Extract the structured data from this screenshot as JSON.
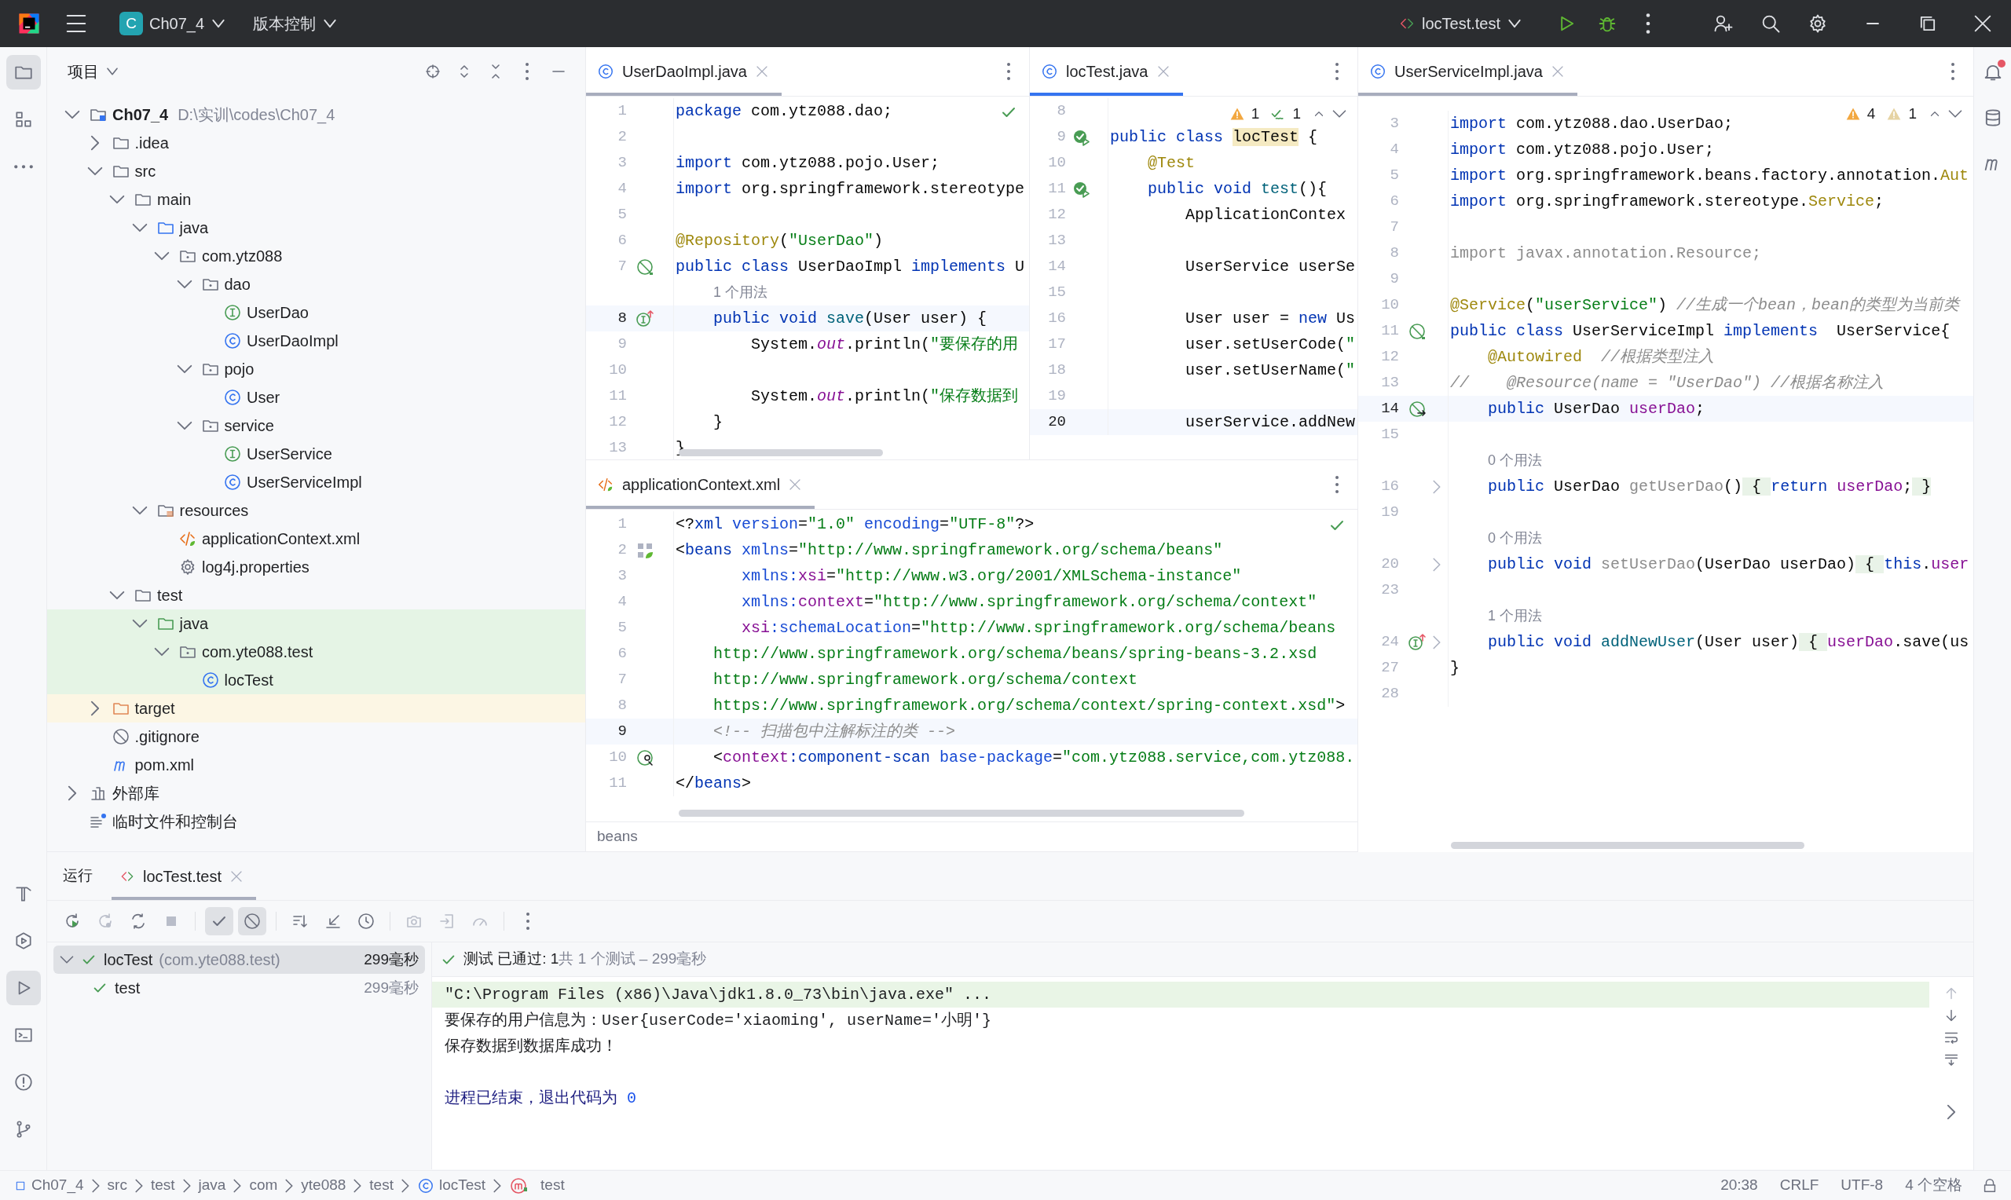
{
  "title_bar": {
    "project_letter": "C",
    "project": "Ch07_4",
    "vcs": "版本控制",
    "run_config": "locTest.test"
  },
  "tool_windows": {
    "left_top": [
      {
        "kind": "project",
        "selected": true
      },
      {
        "kind": "structure",
        "selected": false
      },
      {
        "kind": "more",
        "selected": false
      }
    ],
    "left_bottom": [
      {
        "kind": "build",
        "selected": false
      },
      {
        "kind": "services",
        "selected": false
      },
      {
        "kind": "run",
        "selected": true
      },
      {
        "kind": "terminal",
        "selected": false
      },
      {
        "kind": "problems",
        "selected": false
      },
      {
        "kind": "git",
        "selected": false
      }
    ],
    "right": [
      {
        "kind": "notifications",
        "badge": true
      },
      {
        "kind": "database"
      },
      {
        "kind": "maven"
      }
    ]
  },
  "project": {
    "title": "项目",
    "tree": [
      {
        "kind": "module",
        "label": "Ch07_4",
        "path": "D:\\实训\\codes\\Ch07_4",
        "expanded": true,
        "children": [
          {
            "kind": "folder",
            "label": ".idea",
            "expanded": false
          },
          {
            "kind": "folder",
            "label": "src",
            "expanded": true,
            "children": [
              {
                "kind": "folder",
                "label": "main",
                "expanded": true,
                "children": [
                  {
                    "kind": "source",
                    "label": "java",
                    "expanded": true,
                    "children": [
                      {
                        "kind": "package",
                        "label": "com.ytz088",
                        "expanded": true,
                        "children": [
                          {
                            "kind": "package",
                            "label": "dao",
                            "expanded": true,
                            "children": [
                              {
                                "kind": "interface",
                                "label": "UserDao"
                              },
                              {
                                "kind": "class",
                                "label": "UserDaoImpl"
                              }
                            ]
                          },
                          {
                            "kind": "package",
                            "label": "pojo",
                            "expanded": true,
                            "children": [
                              {
                                "kind": "class",
                                "label": "User"
                              }
                            ]
                          },
                          {
                            "kind": "package",
                            "label": "service",
                            "expanded": true,
                            "children": [
                              {
                                "kind": "interface",
                                "label": "UserService"
                              },
                              {
                                "kind": "class",
                                "label": "UserServiceImpl"
                              }
                            ]
                          }
                        ]
                      }
                    ]
                  },
                  {
                    "kind": "resources",
                    "label": "resources",
                    "expanded": true,
                    "children": [
                      {
                        "kind": "xml",
                        "label": "applicationContext.xml"
                      },
                      {
                        "kind": "properties",
                        "label": "log4j.properties"
                      }
                    ]
                  }
                ]
              },
              {
                "kind": "folder",
                "label": "test",
                "expanded": true,
                "children": [
                  {
                    "kind": "test-source",
                    "label": "java",
                    "expanded": true,
                    "color": "#e5f4e5",
                    "children": [
                      {
                        "kind": "package",
                        "label": "com.yte088.test",
                        "expanded": true,
                        "color": "#e5f4e5",
                        "children": [
                          {
                            "kind": "class",
                            "label": "locTest",
                            "color": "#e5f4e5"
                          }
                        ]
                      }
                    ]
                  }
                ]
              }
            ]
          },
          {
            "kind": "excluded",
            "label": "target",
            "expanded": false,
            "color": "#fcf6e4"
          },
          {
            "kind": "ignore",
            "label": ".gitignore"
          },
          {
            "kind": "maven",
            "label": "pom.xml"
          }
        ]
      },
      {
        "kind": "library",
        "label": "外部库",
        "expanded": false
      },
      {
        "kind": "scratch",
        "label": "临时文件和控制台"
      }
    ]
  },
  "editors": [
    {
      "focused": false,
      "tabs": [
        {
          "label": "UserDaoImpl.java",
          "kind": "class",
          "selected": true
        }
      ],
      "inspection": {
        "kind": "ok"
      },
      "lines": [
        {
          "n": "1",
          "tokens": [
            {
              "text": "package",
              "kind": "kw"
            },
            {
              "text": " com.ytz088.dao;",
              "kind": "plain"
            }
          ]
        },
        {
          "n": "2"
        },
        {
          "n": "3",
          "tokens": [
            {
              "text": "import",
              "kind": "kw"
            },
            {
              "text": " com.ytz088.pojo.User;",
              "kind": "plain"
            }
          ]
        },
        {
          "n": "4",
          "tokens": [
            {
              "text": "import",
              "kind": "kw"
            },
            {
              "text": " org.springframework.stereotype",
              "kind": "plain"
            }
          ]
        },
        {
          "n": "5"
        },
        {
          "n": "6",
          "tokens": [
            {
              "text": "@Repository",
              "kind": "ann"
            },
            {
              "text": "(",
              "kind": "plain"
            },
            {
              "text": "\"UserDao\"",
              "kind": "str"
            },
            {
              "text": ")",
              "kind": "plain"
            }
          ]
        },
        {
          "n": "7",
          "marker": {
            "kind": "bean"
          },
          "tokens": [
            {
              "text": "public class",
              "kind": "kw"
            },
            {
              "text": " UserDaoImpl ",
              "kind": "plain"
            },
            {
              "text": "implements",
              "kind": "kw"
            },
            {
              "text": " U",
              "kind": "plain"
            }
          ]
        },
        {
          "kind": "hint",
          "text": "1 个用法"
        },
        {
          "n": "8",
          "marker": {
            "kind": "impl"
          },
          "current": true,
          "tokens": [
            {
              "text": "    public void",
              "kind": "kw"
            },
            {
              "text": " save",
              "kind": "decl"
            },
            {
              "text": "(User user) {",
              "kind": "plain"
            }
          ]
        },
        {
          "n": "9",
          "tokens": [
            {
              "text": "        System.",
              "kind": "plain"
            },
            {
              "text": "out",
              "kind": "static"
            },
            {
              "text": ".println(",
              "kind": "plain"
            },
            {
              "text": "\"要保存的用",
              "kind": "str"
            }
          ]
        },
        {
          "n": "10"
        },
        {
          "n": "11",
          "tokens": [
            {
              "text": "        System.",
              "kind": "plain"
            },
            {
              "text": "out",
              "kind": "static"
            },
            {
              "text": ".println(",
              "kind": "plain"
            },
            {
              "text": "\"保存数据到",
              "kind": "str"
            }
          ]
        },
        {
          "n": "12",
          "tokens": [
            {
              "text": "    }",
              "kind": "plain"
            }
          ]
        },
        {
          "n": "13",
          "tokens": [
            {
              "text": "}",
              "kind": "plain"
            }
          ]
        }
      ]
    },
    {
      "focused": true,
      "tabs": [
        {
          "label": "locTest.java",
          "kind": "class",
          "selected": true
        }
      ],
      "inspection": {
        "kind": "counts",
        "counts": [
          {
            "kind": "warning",
            "text": "1"
          },
          {
            "kind": "typo",
            "text": "1"
          }
        ]
      },
      "lines": [
        {
          "n": "8"
        },
        {
          "n": "9",
          "marker": {
            "kind": "run"
          },
          "tokens": [
            {
              "text": "public class ",
              "kind": "kw"
            },
            {
              "text": "locTest",
              "kind": "match"
            },
            {
              "text": " {",
              "kind": "plain"
            }
          ]
        },
        {
          "n": "10",
          "tokens": [
            {
              "text": "    @Test",
              "kind": "ann"
            }
          ]
        },
        {
          "n": "11",
          "marker": {
            "kind": "run"
          },
          "tokens": [
            {
              "text": "    public void",
              "kind": "kw"
            },
            {
              "text": " test",
              "kind": "decl"
            },
            {
              "text": "(){",
              "kind": "plain"
            }
          ]
        },
        {
          "n": "12",
          "tokens": [
            {
              "text": "        ApplicationContex",
              "kind": "plain"
            }
          ]
        },
        {
          "n": "13"
        },
        {
          "n": "14",
          "tokens": [
            {
              "text": "        UserService userSe",
              "kind": "plain"
            }
          ]
        },
        {
          "n": "15"
        },
        {
          "n": "16",
          "tokens": [
            {
              "text": "        User user = ",
              "kind": "plain"
            },
            {
              "text": "new",
              "kind": "kw"
            },
            {
              "text": " Us",
              "kind": "plain"
            }
          ]
        },
        {
          "n": "17",
          "tokens": [
            {
              "text": "        user.setUserCode(",
              "kind": "plain"
            },
            {
              "text": "\"",
              "kind": "str"
            }
          ]
        },
        {
          "n": "18",
          "tokens": [
            {
              "text": "        user.setUserName(",
              "kind": "plain"
            },
            {
              "text": "\"",
              "kind": "str"
            }
          ]
        },
        {
          "n": "19"
        },
        {
          "n": "20",
          "current": true,
          "tokens": [
            {
              "text": "        userService.addNew",
              "kind": "plain"
            }
          ]
        }
      ]
    },
    {
      "focused": false,
      "tabs": [
        {
          "label": "applicationContext.xml",
          "kind": "xml",
          "selected": true
        }
      ],
      "inspection": {
        "kind": "ok"
      },
      "breadcrumb": "beans",
      "lines": [
        {
          "n": "1",
          "tokens": [
            {
              "text": "<?",
              "kind": "plain"
            },
            {
              "text": "xml",
              "kind": "tag"
            },
            {
              "text": " version",
              "kind": "attr"
            },
            {
              "text": "=",
              "kind": "plain"
            },
            {
              "text": "\"1.0\"",
              "kind": "str"
            },
            {
              "text": " encoding",
              "kind": "attr"
            },
            {
              "text": "=",
              "kind": "plain"
            },
            {
              "text": "\"UTF-8\"",
              "kind": "str"
            },
            {
              "text": "?>",
              "kind": "plain"
            }
          ]
        },
        {
          "n": "2",
          "marker": {
            "kind": "spring"
          },
          "tokens": [
            {
              "text": "<",
              "kind": "plain"
            },
            {
              "text": "beans",
              "kind": "tag"
            },
            {
              "text": " xmlns",
              "kind": "attr"
            },
            {
              "text": "=",
              "kind": "plain"
            },
            {
              "text": "\"http://www.springframework.org/schema/beans\"",
              "kind": "str"
            }
          ]
        },
        {
          "n": "3",
          "tokens": [
            {
              "text": "       xmlns:",
              "kind": "attr"
            },
            {
              "text": "xsi",
              "kind": "ns"
            },
            {
              "text": "=",
              "kind": "plain"
            },
            {
              "text": "\"http://www.w3.org/2001/XMLSchema-instance\"",
              "kind": "str"
            }
          ]
        },
        {
          "n": "4",
          "tokens": [
            {
              "text": "       xmlns:",
              "kind": "attr"
            },
            {
              "text": "context",
              "kind": "ns"
            },
            {
              "text": "=",
              "kind": "plain"
            },
            {
              "text": "\"http://www.springframework.org/schema/context\"",
              "kind": "str"
            }
          ]
        },
        {
          "n": "5",
          "tokens": [
            {
              "text": "       xsi",
              "kind": "ns"
            },
            {
              "text": ":schemaLocation",
              "kind": "attr"
            },
            {
              "text": "=",
              "kind": "plain"
            },
            {
              "text": "\"http://www.springframework.org/schema/beans",
              "kind": "str"
            }
          ]
        },
        {
          "n": "6",
          "tokens": [
            {
              "text": "    http://www.springframework.org/schema/beans/spring-beans-3.2.xsd",
              "kind": "str"
            }
          ]
        },
        {
          "n": "7",
          "tokens": [
            {
              "text": "    http://www.springframework.org/schema/context",
              "kind": "str"
            }
          ]
        },
        {
          "n": "8",
          "tokens": [
            {
              "text": "    https://www.springframework.org/schema/context/spring-context.xsd\"",
              "kind": "str"
            },
            {
              "text": ">",
              "kind": "plain"
            }
          ]
        },
        {
          "n": "9",
          "current": true,
          "tokens": [
            {
              "text": "    <!-- 扫描包中注解标注的类 -->",
              "kind": "cmt"
            }
          ]
        },
        {
          "n": "10",
          "marker": {
            "kind": "scan"
          },
          "tokens": [
            {
              "text": "    <",
              "kind": "plain"
            },
            {
              "text": "context",
              "kind": "ns"
            },
            {
              "text": ":component-scan",
              "kind": "tag"
            },
            {
              "text": " base-package",
              "kind": "attr"
            },
            {
              "text": "=",
              "kind": "plain"
            },
            {
              "text": "\"com.ytz088.service,com.ytz088.",
              "kind": "str"
            }
          ]
        },
        {
          "n": "11",
          "tokens": [
            {
              "text": "</",
              "kind": "plain"
            },
            {
              "text": "beans",
              "kind": "tag"
            },
            {
              "text": ">",
              "kind": "plain"
            }
          ]
        }
      ]
    },
    {
      "focused": false,
      "tabs": [
        {
          "label": "UserServiceImpl.java",
          "kind": "class",
          "selected": true
        }
      ],
      "inspection": {
        "kind": "counts",
        "counts": [
          {
            "kind": "warning",
            "text": "4"
          },
          {
            "kind": "weak",
            "text": "1"
          }
        ]
      },
      "lines": [
        {
          "n": "3",
          "tokens": [
            {
              "text": "import",
              "kind": "kw"
            },
            {
              "text": " com.ytz088.dao.UserDao;",
              "kind": "plain"
            }
          ]
        },
        {
          "n": "4",
          "tokens": [
            {
              "text": "import",
              "kind": "kw"
            },
            {
              "text": " com.ytz088.pojo.User;",
              "kind": "plain"
            }
          ]
        },
        {
          "n": "5",
          "tokens": [
            {
              "text": "import",
              "kind": "kw"
            },
            {
              "text": " org.springframework.beans.factory.annotation.",
              "kind": "plain"
            },
            {
              "text": "Aut",
              "kind": "ref"
            }
          ]
        },
        {
          "n": "6",
          "tokens": [
            {
              "text": "import",
              "kind": "kw"
            },
            {
              "text": " org.springframework.stereotype.",
              "kind": "plain"
            },
            {
              "text": "Service",
              "kind": "ref"
            },
            {
              "text": ";",
              "kind": "plain"
            }
          ]
        },
        {
          "n": "7"
        },
        {
          "n": "8",
          "tokens": [
            {
              "text": "import javax.annotation.Resource;",
              "kind": "unused"
            }
          ]
        },
        {
          "n": "9"
        },
        {
          "n": "10",
          "tokens": [
            {
              "text": "@Service",
              "kind": "ann"
            },
            {
              "text": "(",
              "kind": "plain"
            },
            {
              "text": "\"userService\"",
              "kind": "str"
            },
            {
              "text": ") ",
              "kind": "plain"
            },
            {
              "text": "//生成一个bean，bean的类型为当前类",
              "kind": "cmt"
            }
          ]
        },
        {
          "n": "11",
          "marker": {
            "kind": "bean"
          },
          "tokens": [
            {
              "text": "public class",
              "kind": "kw"
            },
            {
              "text": " UserServiceImpl ",
              "kind": "plain"
            },
            {
              "text": "implements",
              "kind": "kw"
            },
            {
              "text": "  UserService{",
              "kind": "plain"
            }
          ]
        },
        {
          "n": "12",
          "tokens": [
            {
              "text": "    @Autowired",
              "kind": "ann"
            },
            {
              "text": "  //根据类型注入",
              "kind": "cmt"
            }
          ]
        },
        {
          "n": "13",
          "tokens": [
            {
              "text": "//    @Resource(name = \"UserDao\") //根据名称注入",
              "kind": "cmt"
            }
          ]
        },
        {
          "n": "14",
          "marker": {
            "kind": "autowired"
          },
          "current": true,
          "tokens": [
            {
              "text": "    public",
              "kind": "kw"
            },
            {
              "text": " UserDao ",
              "kind": "plain"
            },
            {
              "text": "userDao",
              "kind": "field"
            },
            {
              "text": ";",
              "kind": "plain"
            }
          ]
        },
        {
          "n": "15"
        },
        {
          "kind": "hint",
          "text": "0 个用法"
        },
        {
          "n": "16",
          "folded": true,
          "tokens": [
            {
              "text": "    public",
              "kind": "kw"
            },
            {
              "text": " UserDao ",
              "kind": "plain"
            },
            {
              "text": "getUserDao",
              "kind": "unused"
            },
            {
              "text": "()",
              "kind": "plain"
            },
            {
              "text": " { ",
              "kind": "fold"
            },
            {
              "text": "return",
              "kind": "kw"
            },
            {
              "text": " userDao",
              "kind": "field"
            },
            {
              "text": ";",
              "kind": "plain"
            },
            {
              "text": " }",
              "kind": "fold"
            }
          ]
        },
        {
          "n": "19"
        },
        {
          "kind": "hint",
          "text": "0 个用法"
        },
        {
          "n": "20",
          "folded": true,
          "tokens": [
            {
              "text": "    public void",
              "kind": "kw"
            },
            {
              "text": " setUserDao",
              "kind": "unused"
            },
            {
              "text": "(UserDao userDao)",
              "kind": "plain"
            },
            {
              "text": " { ",
              "kind": "fold"
            },
            {
              "text": "this",
              "kind": "kw"
            },
            {
              "text": ".",
              "kind": "plain"
            },
            {
              "text": "user",
              "kind": "field"
            }
          ]
        },
        {
          "n": "23"
        },
        {
          "kind": "hint",
          "text": "1 个用法"
        },
        {
          "n": "24",
          "marker": {
            "kind": "impl"
          },
          "folded": true,
          "tokens": [
            {
              "text": "    public void",
              "kind": "kw"
            },
            {
              "text": " addNewUser",
              "kind": "decl"
            },
            {
              "text": "(User user)",
              "kind": "plain"
            },
            {
              "text": " { ",
              "kind": "fold"
            },
            {
              "text": "userDao",
              "kind": "field"
            },
            {
              "text": ".save(us",
              "kind": "plain"
            }
          ]
        },
        {
          "n": "27",
          "tokens": [
            {
              "text": "}",
              "kind": "plain"
            }
          ]
        },
        {
          "n": "28"
        }
      ]
    }
  ],
  "run": {
    "title": "运行",
    "tabs": [
      {
        "label": "locTest.test",
        "selected": true
      }
    ],
    "toolbar": [
      {
        "kind": "rerun",
        "disabled": false
      },
      {
        "kind": "rerun-failed",
        "disabled": true
      },
      {
        "kind": "auto",
        "disabled": false
      },
      {
        "kind": "stop",
        "disabled": true
      },
      {
        "kind": "passed",
        "disabled": false,
        "on": true
      },
      {
        "kind": "ignored",
        "disabled": false,
        "on": true
      },
      {
        "kind": "sort",
        "disabled": false
      },
      {
        "kind": "collapse",
        "disabled": false
      },
      {
        "kind": "history",
        "disabled": false
      },
      {
        "kind": "camera",
        "disabled": true
      },
      {
        "kind": "export",
        "disabled": true
      },
      {
        "kind": "gauge",
        "disabled": true
      },
      {
        "kind": "more",
        "disabled": false
      }
    ],
    "tests": [
      {
        "name": "locTest",
        "detail": "(com.yte088.test)",
        "time": "299毫秒",
        "passed": true,
        "selected": true,
        "expanded": true,
        "children": [
          {
            "name": "test",
            "time": "299毫秒",
            "passed": true,
            "selected": false
          }
        ]
      }
    ],
    "summary": {
      "passed": true,
      "text": "测试 已通过: 1",
      "detail": "共 1 个测试 – 299毫秒"
    },
    "console": [
      {
        "kind": "command",
        "text": "\"C:\\Program Files (x86)\\Java\\jdk1.8.0_73\\bin\\java.exe\" ..."
      },
      {
        "kind": "output",
        "text": "要保存的用户信息为：User{userCode='xiaoming', userName='小明'}"
      },
      {
        "kind": "output",
        "text": "保存数据到数据库成功！"
      },
      {
        "kind": "exit",
        "text": "进程已结束，退出代码为",
        "code": "0"
      }
    ]
  },
  "status_bar": {
    "breadcrumbs": [
      {
        "kind": "module",
        "text": "Ch07_4"
      },
      {
        "text": "src"
      },
      {
        "text": "test"
      },
      {
        "text": "java"
      },
      {
        "text": "com"
      },
      {
        "text": "yte088"
      },
      {
        "text": "test"
      },
      {
        "kind": "class",
        "text": "locTest"
      },
      {
        "kind": "method",
        "text": "test"
      }
    ],
    "items": [
      "20:38",
      "CRLF",
      "UTF-8",
      "4 个空格"
    ]
  }
}
